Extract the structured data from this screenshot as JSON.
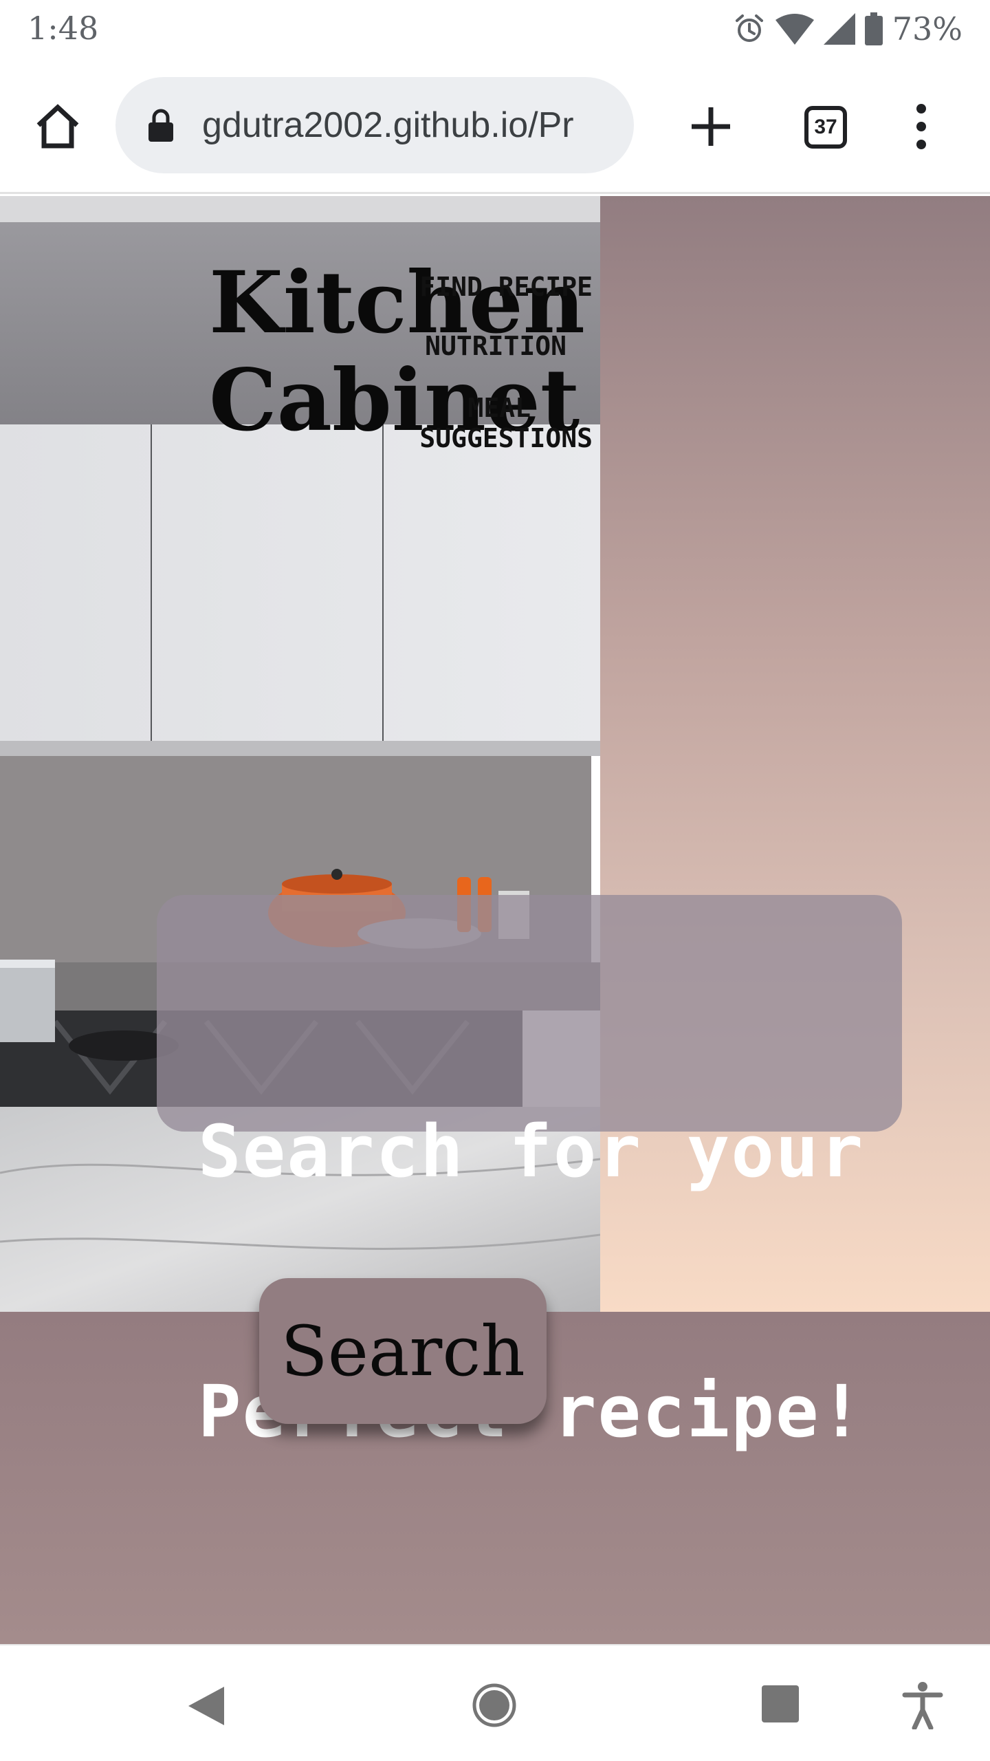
{
  "status_bar": {
    "time": "1:48",
    "battery_percent": "73%",
    "icons": [
      "alarm-icon",
      "wifi-icon",
      "cell-signal-icon",
      "battery-icon"
    ]
  },
  "browser": {
    "url": "gdutra2002.github.io/Pr",
    "tab_count": "37",
    "icons": [
      "home-icon",
      "lock-icon",
      "new-tab-icon",
      "tab-switcher-icon",
      "more-menu-icon"
    ]
  },
  "site": {
    "title_line1": "Kitchen",
    "title_line2": "Cabinet",
    "nav": {
      "find_recipe": "FIND RECIPE",
      "nutrition": "NUTRITION",
      "meal": "MEAL",
      "suggestions": "SUGGESTIONS"
    },
    "hero_heading_line1": "Search for your",
    "hero_heading_line2": "Perfect recipe!",
    "search_button": "Search"
  },
  "colors": {
    "accent_mauve": "#927d81",
    "hero_gradient_bottom": "#f8dbc6",
    "card_overlay": "#968c98"
  },
  "system_nav": {
    "icons": [
      "back-icon",
      "home-circle-icon",
      "recents-icon",
      "accessibility-icon"
    ]
  }
}
